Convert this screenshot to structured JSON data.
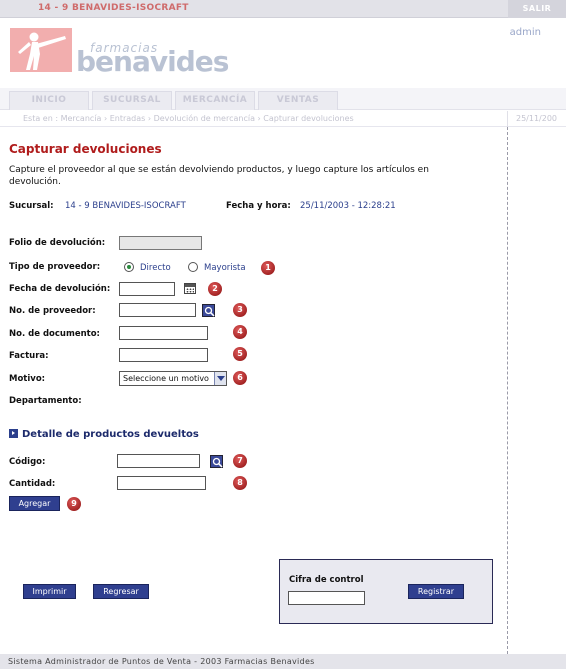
{
  "topbar": {
    "store": "14 - 9    BENAVIDES-ISOCRAFT",
    "logout": "SALIR"
  },
  "header": {
    "brand_small": "farmacias",
    "brand_big": "benavides",
    "user": "admin"
  },
  "nav": {
    "tabs": [
      "INICIO",
      "SUCURSAL",
      "MERCANCÍA",
      "VENTAS"
    ]
  },
  "breadcrumb": {
    "text": "Esta en : Mercancía › Entradas › Devolución de mercancía › Capturar devoluciones",
    "date": "25/11/200"
  },
  "page": {
    "title": "Capturar devoluciones",
    "intro": "Capture el proveedor al que se están devolviendo productos, y luego capture los artículos en devolución."
  },
  "info": {
    "sucursal_label": "Sucursal:",
    "sucursal_value": "14 - 9  BENAVIDES-ISOCRAFT",
    "fecha_label": "Fecha y hora:",
    "fecha_value": "25/11/2003 - 12:28:21"
  },
  "form": {
    "folio_label": "Folio de devolución:",
    "tipo_label": "Tipo de proveedor:",
    "tipo_options": [
      "Directo",
      "Mayorista"
    ],
    "tipo_selected": "Directo",
    "fecha_label": "Fecha de devolución:",
    "proveedor_label": "No. de proveedor:",
    "documento_label": "No. de documento:",
    "factura_label": "Factura:",
    "motivo_label": "Motivo:",
    "motivo_value": "Seleccione un motivo",
    "departamento_label": "Departamento:"
  },
  "detalle": {
    "title": "Detalle de productos devueltos",
    "codigo_label": "Código:",
    "cantidad_label": "Cantidad:",
    "agregar_label": "Agregar"
  },
  "badges": [
    "1",
    "2",
    "3",
    "4",
    "5",
    "6",
    "7",
    "8",
    "9"
  ],
  "actions": {
    "imprimir": "Imprimir",
    "regresar": "Regresar",
    "registrar": "Registrar",
    "cifra_label": "Cifra de control"
  },
  "footer": {
    "text": "Sistema Administrador de Puntos de Venta - 2003 Farmacias Benavides"
  },
  "icons": {
    "search": "magnifier-icon",
    "calendar": "calendar-icon",
    "dropdown": "chevron-down-icon",
    "section": "play-arrow-icon"
  },
  "colors": {
    "title": "#b01c1c",
    "value": "#2b3f8c",
    "button": "#2f3f8f",
    "badge": "#a01818"
  }
}
